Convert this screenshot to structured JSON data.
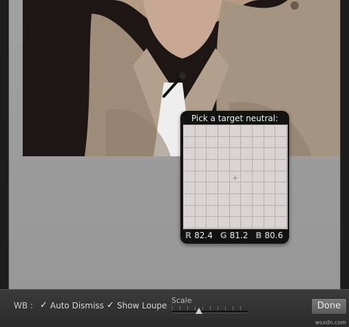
{
  "loupe": {
    "title": "Pick a target neutral:",
    "r_label": "R",
    "r_value": "82.4",
    "g_label": "G",
    "g_value": "81.2",
    "b_label": "B",
    "b_value": "80.6",
    "unit": "%"
  },
  "toolbar": {
    "wb_label": "WB :",
    "auto_dismiss": "Auto Dismiss",
    "show_loupe": "Show Loupe",
    "scale_label": "Scale",
    "done_label": "Done",
    "check_glyph": "✓"
  },
  "watermark": "wsxdn.com",
  "colors": {
    "toolbar_bg": "#333333",
    "loupe_bg": "#121212",
    "canvas_bg": "#9b9b9b"
  }
}
